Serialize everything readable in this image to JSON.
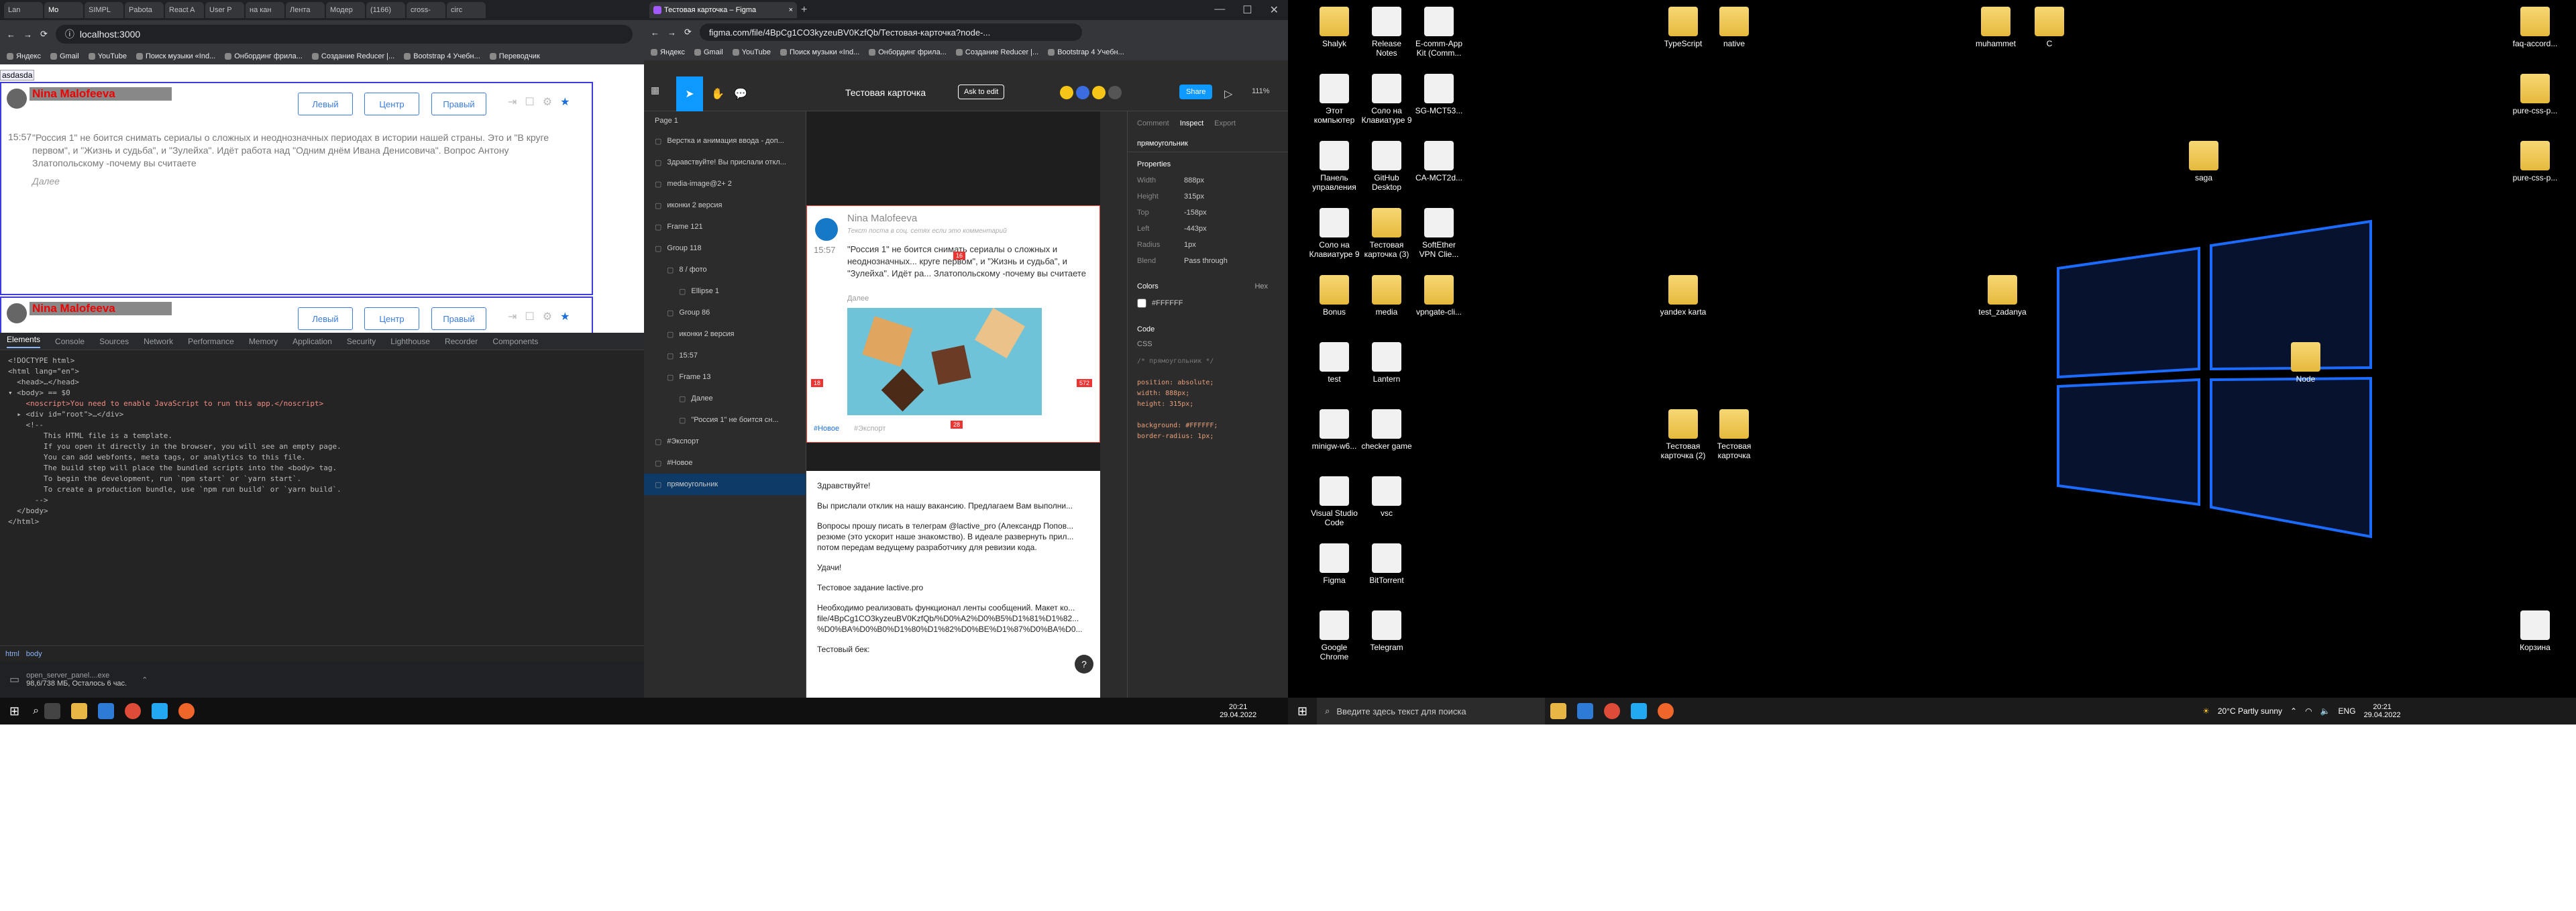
{
  "left_browser": {
    "tabs": [
      "Lan",
      "Mo",
      "SIMPL",
      "Pabota",
      "React A",
      "User P",
      "на кан",
      "Лента",
      "Модер",
      "(1166)",
      "cross-",
      "circ"
    ],
    "address": "localhost:3000",
    "bookmarks": [
      "Яндекс",
      "Gmail",
      "YouTube",
      "Поиск музыки «Ind...",
      "Онбординг фрила...",
      "Создание Reducer |...",
      "Bootstrap 4 Учебн...",
      "Переводчик"
    ],
    "top_text": "asdasda",
    "messages": [
      {
        "author": "Nina Malofeeva",
        "time": "15:57",
        "text": "\"Россия 1\" не боится снимать сериалы о сложных и неоднозначных периодах в истории нашей страны. Это и \"В круге первом\", и \"Жизнь и судьба\", и \"Зулейха\". Идёт работа над \"Одним днём Ивана Денисовича\". Вопрос Антону Златопольскому -почему вы считаете",
        "more": "Далее"
      },
      {
        "author": "Nina Malofeeva"
      }
    ],
    "align_buttons": [
      "Левый",
      "Центр",
      "Правый"
    ]
  },
  "devtools": {
    "tabs": [
      "Elements",
      "Console",
      "Sources",
      "Network",
      "Performance",
      "Memory",
      "Application",
      "Security",
      "Lighthouse",
      "Recorder",
      "Components"
    ],
    "code": [
      "<!DOCTYPE html>",
      "<html lang=\"en\">",
      "  <head>…</head>",
      "▾ <body> == $0",
      "    <noscript>You need to enable JavaScript to run this app.</noscript>",
      "  ▸ <div id=\"root\">…</div>",
      "    <!--",
      "        This HTML file is a template.",
      "        If you open it directly in the browser, you will see an empty page.",
      "",
      "        You can add webfonts, meta tags, or analytics to this file.",
      "        The build step will place the bundled scripts into the <body> tag.",
      "",
      "        To begin the development, run `npm start` or `yarn start`.",
      "        To create a production bundle, use `npm run build` or `yarn build`.",
      "      -->",
      "  </body>",
      "</html>"
    ],
    "breadcrumb": [
      "html",
      "body"
    ],
    "download": {
      "name": "open_server_panel....exe",
      "status": "98,6/738 МБ, Осталось 6 час."
    }
  },
  "figma": {
    "tab_title": "Тестовая карточка – Figma",
    "address": "figma.com/file/4BpCg1CO3kyzeuBV0KzfQb/Тестовая-карточка?node-...",
    "bookmarks": [
      "Яндекс",
      "Gmail",
      "YouTube",
      "Поиск музыки «Ind...",
      "Онбординг фрила...",
      "Создание Reducer |...",
      "Bootstrap 4 Учебн..."
    ],
    "file_name": "Тестовая карточка",
    "ask_to_edit": "Ask to edit",
    "share": "Share",
    "zoom": "111%",
    "page": "Page 1",
    "layers": [
      "Верстка и анимация ввода - доп...",
      "Здравствуйте! Вы прислали откл...",
      "media-image@2+ 2",
      "иконки 2 версия",
      "Frame 121",
      "Group 118",
      "8 / фото",
      "Ellipse 1",
      "Group 86",
      "иконки 2 версия",
      "15:57",
      "Frame 13",
      "Далее",
      "\"Россия 1\" не боится сн...",
      "#Экспорт",
      "#Новое",
      "прямоугольник"
    ],
    "card": {
      "author": "Nina Malofeeva",
      "subtitle": "Текст поста в соц. сетях если это комментарий",
      "time": "15:57",
      "text": "\"Россия 1\" не боится снимать сериалы о сложных и неоднозначных... круге первом\", и \"Жизнь и судьба\", и \"Зулейха\". Идёт ра... Златопольскому -почему вы считаете",
      "more": "Далее",
      "tags": [
        "#Новое",
        "#Экспорт"
      ],
      "badge": "16",
      "dims": [
        "18",
        "572",
        "28"
      ]
    },
    "doc_text": [
      "Здравствуйте!",
      "Вы прислали отклик на нашу вакансию. Предлагаем Вам выполни...",
      "Вопросы прошу писать в телеграм @lactive_pro (Александр Попов... резюме (это ускорит наше знакомство). В идеале развернуть прил... потом передам ведущему разработчику для ревизии кода.",
      "Удачи!",
      "Тестовое задание lactive.pro",
      "Необходимо реализовать функционал ленты сообщений. Макет ко... file/4BpCg1CO3kyzeuBV0KzfQb/%D0%A2%D0%B5%D1%81%D1%82... %D0%BA%D0%B0%D1%80%D1%82%D0%BE%D1%87%D0%BA%D0...",
      "Тестовый бек:"
    ],
    "inspect_tabs": [
      "Comment",
      "Inspect",
      "Export"
    ],
    "selection": "прямоугольник",
    "properties": [
      {
        "k": "Width",
        "v": "888px"
      },
      {
        "k": "Height",
        "v": "315px"
      },
      {
        "k": "Top",
        "v": "-158px"
      },
      {
        "k": "Left",
        "v": "-443px"
      },
      {
        "k": "Radius",
        "v": "1px"
      },
      {
        "k": "Blend",
        "v": "Pass through"
      }
    ],
    "colors_title": "Colors",
    "color_mode": "Hex",
    "color_value": "#FFFFFF",
    "code_title": "Code",
    "code_lang": "CSS",
    "css": [
      "/* прямоугольник */",
      "",
      "position: absolute;",
      "width: 888px;",
      "height: 315px;",
      "",
      "background: #FFFFFF;",
      "border-radius: 1px;"
    ]
  },
  "taskbar_left": {
    "time": "20:21",
    "date": "29.04.2022"
  },
  "taskbar_right": {
    "search_placeholder": "Введите здесь текст для поиска",
    "weather": "20°C  Partly sunny",
    "lang": "ENG",
    "time": "20:21",
    "date": "29.04.2022"
  },
  "desktop_icons": [
    "Shalyk",
    "Release Notes",
    "E-comm-App Kit (Comm...",
    "Этот компьютер",
    "Соло на Клавиатуре 9",
    "SG-MCT53...",
    "Панель управления",
    "GitHub Desktop",
    "CA-MCT2d...",
    "Соло на Клавиатуре 9",
    "Тестовая карточка (3)",
    "SoftEther VPN Clie...",
    "Bonus",
    "media",
    "vpngate-cli...",
    "test",
    "Lantern",
    "minigw-w6...",
    "checker game",
    "Visual Studio Code",
    "vsc",
    "Figma",
    "BitTorrent",
    "Google Chrome",
    "Telegram",
    "TypeScript",
    "native",
    "muhammet",
    "C",
    "faq-accord...",
    "pure-css-p...",
    "saga",
    "pure-css-p...",
    "yandex karta",
    "test_zadanya",
    "Node",
    "Тестовая карточка (2)",
    "Тестовая карточка",
    "Корзина"
  ]
}
